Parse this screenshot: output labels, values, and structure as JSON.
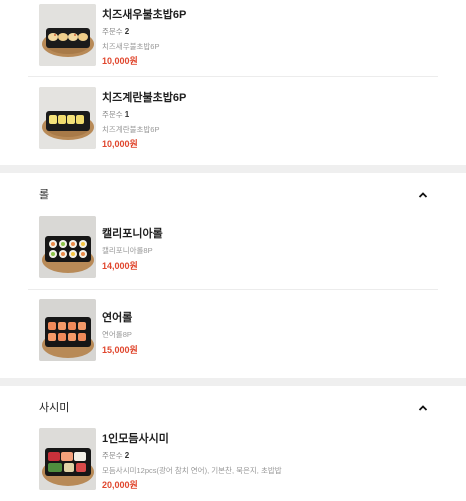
{
  "sections": [
    {
      "title": "",
      "items": [
        {
          "name": "치즈새우불초밥6P",
          "qty_label": "주문수",
          "qty": "2",
          "desc": "치즈새우불초밥6P",
          "price": "10,000원"
        },
        {
          "name": "치즈계란불초밥6P",
          "qty_label": "주문수",
          "qty": "1",
          "desc": "치즈계란불초밥6P",
          "price": "10,000원"
        }
      ]
    },
    {
      "title": "롤",
      "items": [
        {
          "name": "캘리포니아롤",
          "desc": "캘리포니아롤8P",
          "price": "14,000원"
        },
        {
          "name": "연어롤",
          "desc": "연어롤8P",
          "price": "15,000원"
        }
      ]
    },
    {
      "title": "사시미",
      "items": [
        {
          "name": "1인모듬사시미",
          "qty_label": "주문수",
          "qty": "2",
          "desc": "모듬사시미12pcs(광어 참치 연어), 기본찬, 묵은지, 초밥밥",
          "price": "20,000원"
        }
      ]
    }
  ],
  "colors": {
    "price": "#e0472e",
    "band": "#efefef",
    "divider": "#ececec"
  },
  "icons": {
    "collapse": "chevron-up-icon"
  }
}
